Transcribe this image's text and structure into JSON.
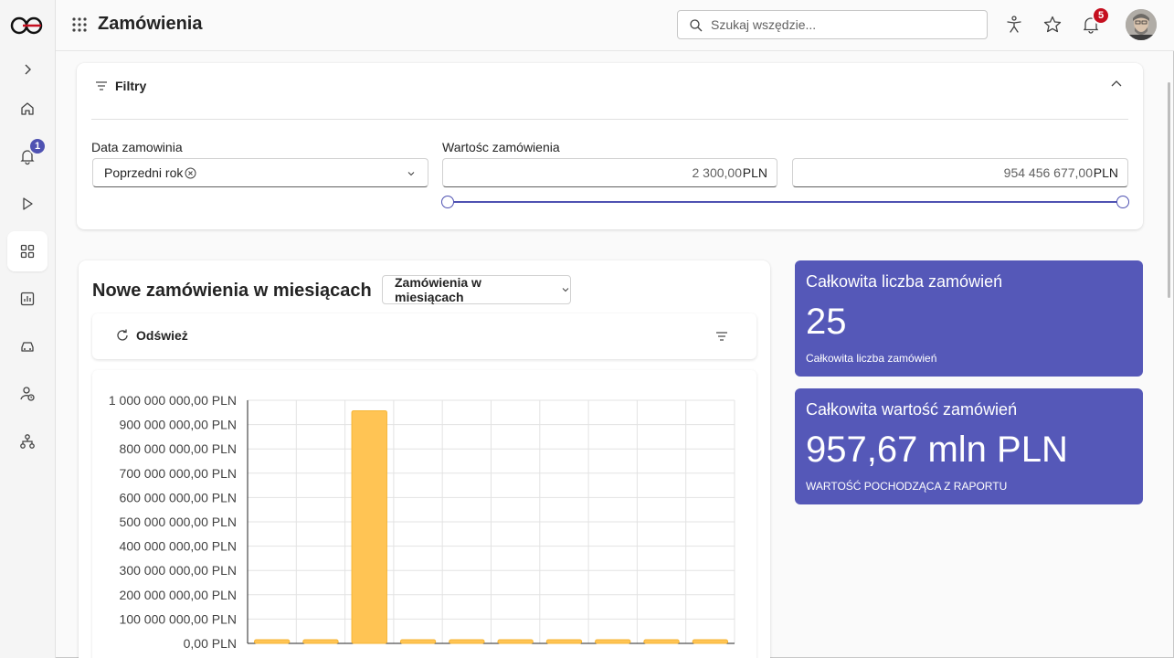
{
  "app": {
    "page_title": "Zamówienia"
  },
  "search": {
    "placeholder": "Szukaj wszędzie..."
  },
  "notifications": {
    "count": "5"
  },
  "rail": {
    "notification_badge": "1"
  },
  "filters": {
    "header": "Filtry",
    "date_label": "Data zamowinia",
    "date_value": "Poprzedni rok",
    "value_label": "Wartośc zamówienia",
    "min_value": "2 300,00",
    "max_value": "954 456 677,00",
    "currency": "PLN"
  },
  "chart_section": {
    "title": "Nowe zamówienia w miesiącach",
    "view_selector": "Zamówienia w miesiącach",
    "refresh_label": "Odśwież"
  },
  "kpis": [
    {
      "title": "Całkowita liczba zamówień",
      "value": "25",
      "subtitle": "Całkowita liczba zamówień"
    },
    {
      "title": "Całkowita wartość zamówień",
      "value": "957,67 mln PLN",
      "subtitle": "WARTOŚĆ POCHODZĄCA Z RAPORTU"
    }
  ],
  "chart_data": {
    "type": "bar",
    "title": "",
    "xlabel": "",
    "ylabel": "",
    "ylim": [
      0,
      1000000000
    ],
    "y_ticks": [
      "0,00 PLN",
      "100 000 000,00 PLN",
      "200 000 000,00 PLN",
      "300 000 000,00 PLN",
      "400 000 000,00 PLN",
      "500 000 000,00 PLN",
      "600 000 000,00 PLN",
      "700 000 000,00 PLN",
      "800 000 000,00 PLN",
      "900 000 000,00 PLN",
      "1 000 000 000,00 PLN"
    ],
    "values": [
      1500000,
      1500000,
      957000000,
      1500000,
      1500000,
      1500000,
      1500000,
      1500000,
      1500000,
      1500000
    ],
    "bar_color": "#ffc454",
    "grid": true
  },
  "colors": {
    "accent": "#4f52b2",
    "kpi_bg": "#5558b8",
    "notification_badge": "#c50f1f"
  }
}
